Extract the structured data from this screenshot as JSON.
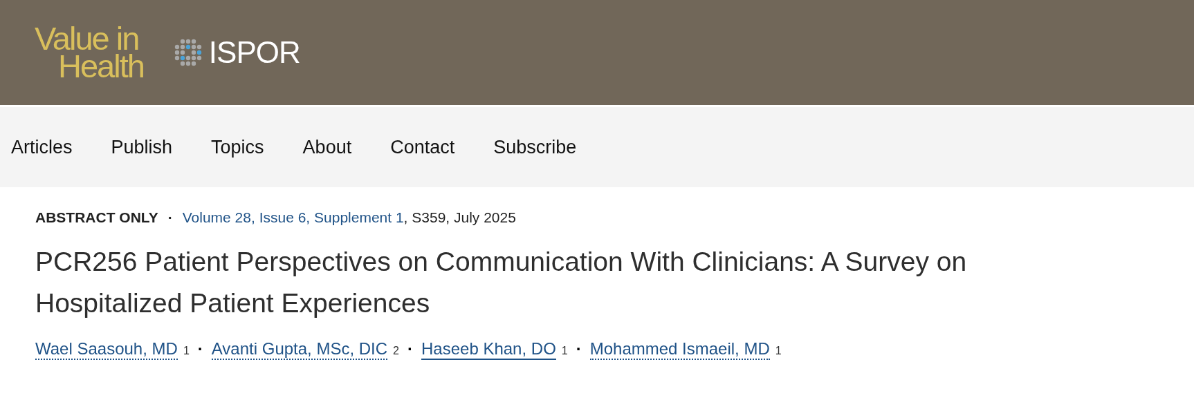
{
  "header": {
    "journal_logo": {
      "line_1": "Value in",
      "line_2": "Health"
    },
    "partner_logo": {
      "text": "ISPOR"
    }
  },
  "nav": {
    "items": [
      {
        "label": "Articles"
      },
      {
        "label": "Publish"
      },
      {
        "label": "Topics"
      },
      {
        "label": "About"
      },
      {
        "label": "Contact"
      },
      {
        "label": "Subscribe"
      }
    ]
  },
  "article": {
    "type_label": "ABSTRACT ONLY",
    "separator": "·",
    "issue_link": "Volume 28, Issue 6, Supplement 1",
    "issue_rest": ", S359, July 2025",
    "title": "PCR256 Patient Perspectives on Communication With Clinicians: A Survey on Hospitalized Patient Experiences",
    "authors": [
      {
        "name": "Wael Saasouh, MD",
        "affiliation": "1",
        "hovered": false
      },
      {
        "name": "Avanti Gupta, MSc, DIC",
        "affiliation": "2",
        "hovered": false
      },
      {
        "name": "Haseeb Khan, DO",
        "affiliation": "1",
        "hovered": true
      },
      {
        "name": "Mohammed Ismaeil, MD",
        "affiliation": "1",
        "hovered": false
      }
    ],
    "author_separator": "·"
  }
}
